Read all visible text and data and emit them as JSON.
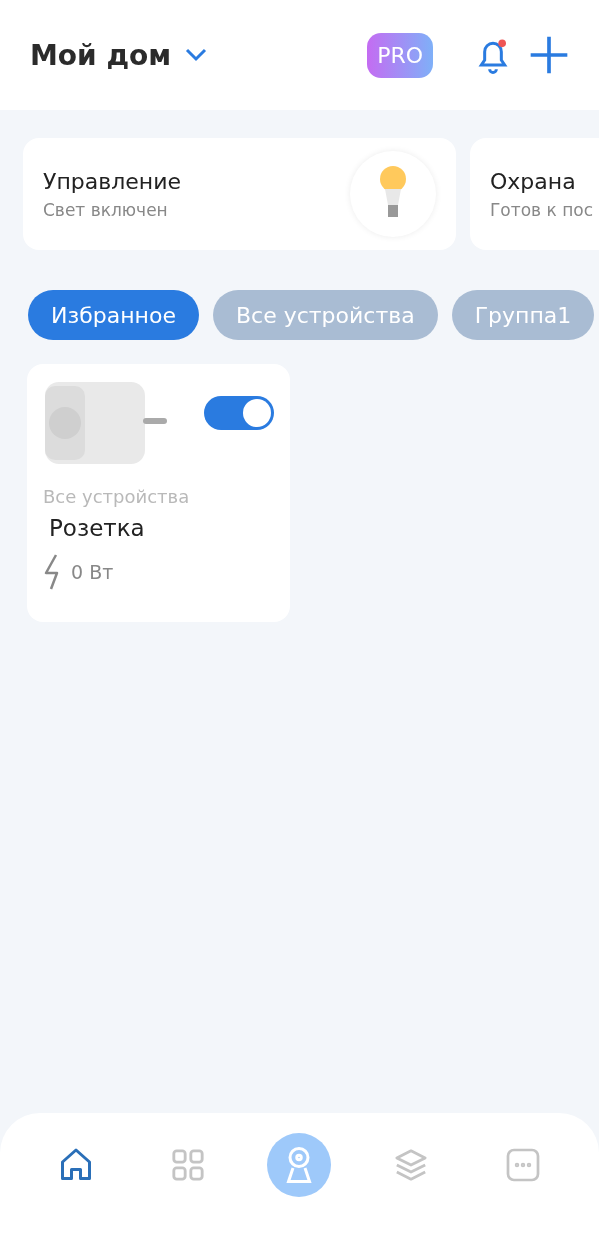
{
  "header": {
    "title": "Мой дом",
    "badge": "PRO",
    "notification_unread": true
  },
  "scenes": [
    {
      "kind": "light",
      "title": "Управление",
      "subtitle": "Свет включен"
    },
    {
      "kind": "security",
      "title": "Охрана",
      "subtitle": "Готов к пос"
    }
  ],
  "filters": [
    {
      "label": "Избранное",
      "selected": true
    },
    {
      "label": "Все устройства",
      "selected": false
    },
    {
      "label": "Группа1",
      "selected": false
    }
  ],
  "devices": [
    {
      "kind": "socket",
      "group": "Все устройства",
      "name": "Розетка",
      "power": "0 Вт",
      "on": true
    }
  ],
  "nav": [
    {
      "kind": "home",
      "selected": true
    },
    {
      "kind": "devices",
      "selected": false
    },
    {
      "kind": "camera",
      "selected": false
    },
    {
      "kind": "scenes",
      "selected": false
    },
    {
      "kind": "more",
      "selected": false
    }
  ]
}
